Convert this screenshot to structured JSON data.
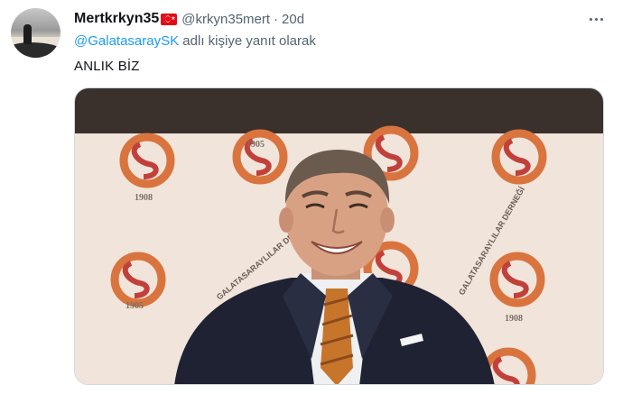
{
  "tweet": {
    "display_name": "Mertkrkyn35",
    "flag": "turkey-flag",
    "handle": "@krkyn35mert",
    "separator": "·",
    "time": "20d",
    "reply_to_handle": "@GalatasaraySK",
    "reply_to_suffix": "adlı kişiye yanıt olarak",
    "text": "ANLIK BİZ",
    "more_icon": "more-horizontal-icon"
  },
  "media": {
    "backdrop_texts": [
      "1905",
      "1908",
      "GALATASARAYLILAR DERNEĞİ"
    ],
    "colors": {
      "banner": "#3a302c",
      "backdrop": "#f1e4da",
      "logo_orange": "#d9743f",
      "logo_red": "#c2403a",
      "suit": "#1f2233",
      "shirt": "#eef0f2",
      "tie": "#c8752c"
    }
  }
}
